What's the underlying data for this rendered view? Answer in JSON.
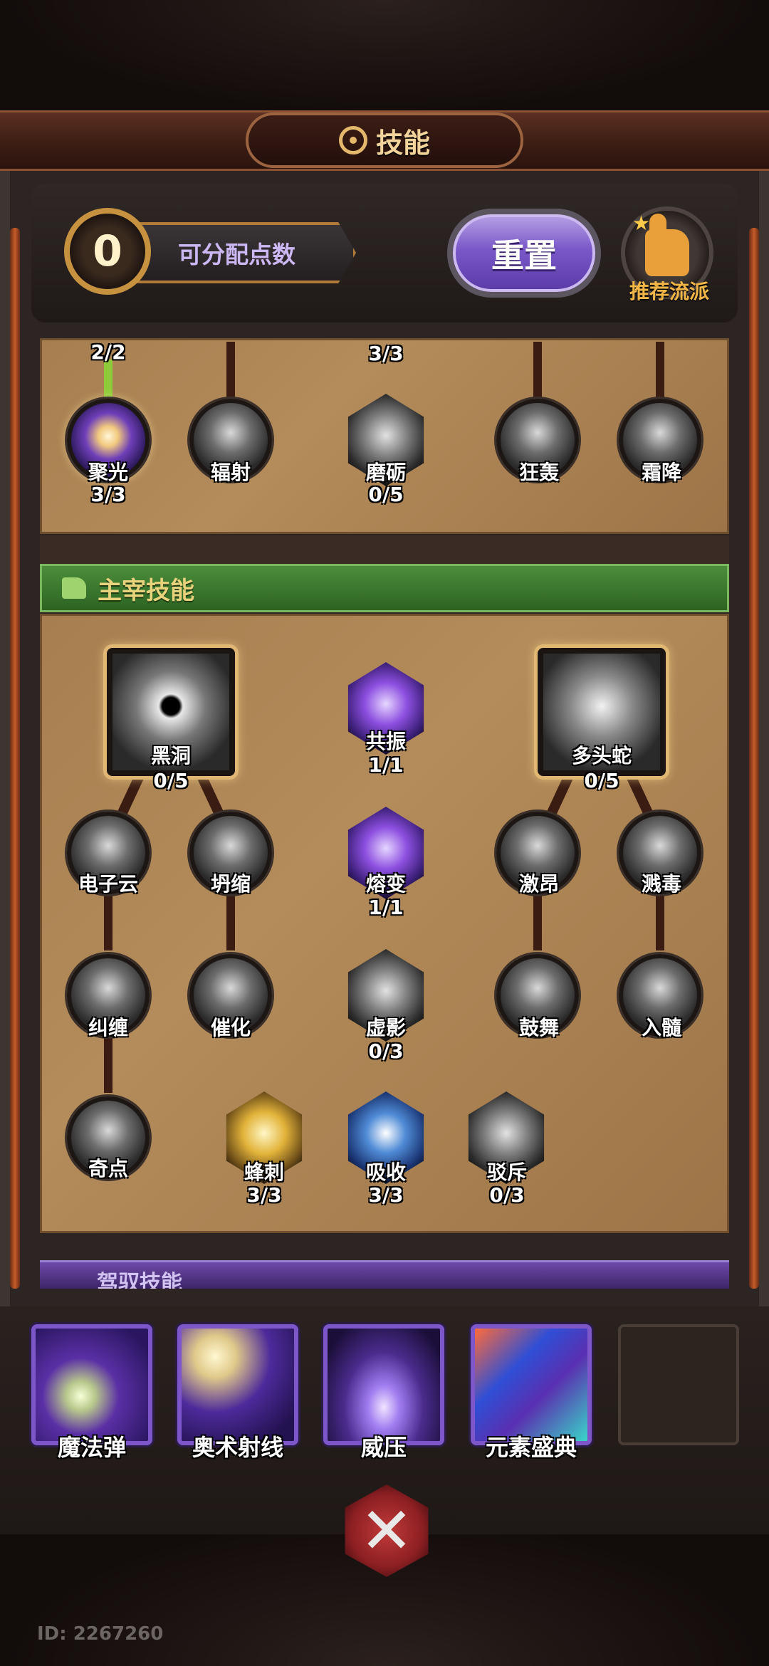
{
  "header": {
    "title": "技能"
  },
  "points": {
    "value": "0",
    "label": "可分配点数"
  },
  "buttons": {
    "reset": "重置",
    "recommend": "推荐流派"
  },
  "top_tree": {
    "counters": [
      "2/2",
      "3/3"
    ],
    "nodes": [
      {
        "name": "聚光",
        "level": "3/3",
        "icon": "light-burst-icon"
      },
      {
        "name": "辐射",
        "level": "",
        "icon": "radiate-icon"
      },
      {
        "name": "磨砺",
        "level": "0/5",
        "icon": "shield-plus-icon"
      },
      {
        "name": "狂轰",
        "level": "",
        "icon": "skull-blast-icon"
      },
      {
        "name": "霜降",
        "level": "",
        "icon": "frost-swirl-icon"
      }
    ]
  },
  "main_skills": {
    "header": "主宰技能",
    "nodes": [
      {
        "name": "黑洞",
        "level": "0/5",
        "icon": "black-hole-icon"
      },
      {
        "name": "共振",
        "level": "1/1",
        "icon": "purple-crystal-icon"
      },
      {
        "name": "多头蛇",
        "level": "0/5",
        "icon": "hydra-icon"
      },
      {
        "name": "电子云",
        "level": "",
        "icon": "electron-cloud-icon"
      },
      {
        "name": "坍缩",
        "level": "",
        "icon": "collapse-icon"
      },
      {
        "name": "熔变",
        "level": "1/1",
        "icon": "fusion-crystal-icon"
      },
      {
        "name": "激昂",
        "level": "",
        "icon": "surge-icon"
      },
      {
        "name": "溅毒",
        "level": "",
        "icon": "splash-poison-icon"
      },
      {
        "name": "纠缠",
        "level": "",
        "icon": "entangle-icon"
      },
      {
        "name": "催化",
        "level": "",
        "icon": "catalyze-icon"
      },
      {
        "name": "虚影",
        "level": "0/3",
        "icon": "phantom-icon"
      },
      {
        "name": "鼓舞",
        "level": "",
        "icon": "inspire-icon"
      },
      {
        "name": "入髓",
        "level": "",
        "icon": "penetrate-icon"
      },
      {
        "name": "奇点",
        "level": "",
        "icon": "singularity-icon"
      },
      {
        "name": "蜂刺",
        "level": "3/3",
        "icon": "bee-sting-icon"
      },
      {
        "name": "吸收",
        "level": "3/3",
        "icon": "absorb-cross-icon"
      },
      {
        "name": "驳斥",
        "level": "0/3",
        "icon": "refute-skull-icon"
      }
    ]
  },
  "driving_skills": {
    "header": "驾驭技能"
  },
  "equipped": [
    "魔法弹",
    "奥术射线",
    "威压",
    "元素盛典"
  ],
  "footer": {
    "id": "ID: 2267260"
  },
  "colors": {
    "accent_purple": "#7d57c9",
    "main_green": "#2c6322",
    "parchment": "#b48c5b"
  }
}
